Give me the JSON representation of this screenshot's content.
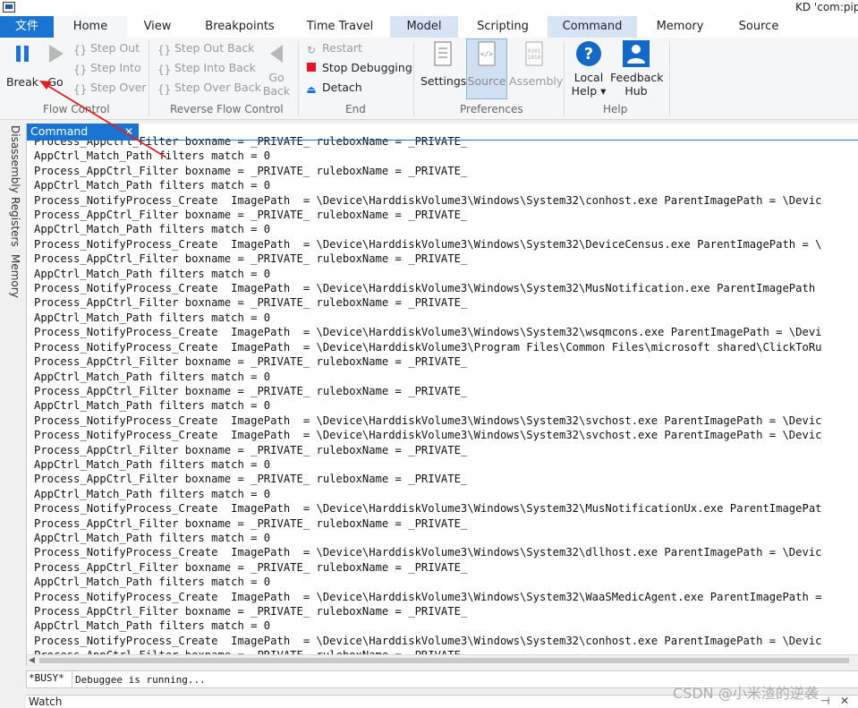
{
  "window": {
    "title": "KD 'com:pip"
  },
  "tabs": [
    "文件",
    "Home",
    "View",
    "Breakpoints",
    "Time Travel",
    "Model",
    "Scripting",
    "Command",
    "Memory",
    "Source"
  ],
  "ribbon": {
    "flow_control": {
      "label": "Flow Control",
      "break": "Break",
      "go": "Go",
      "step_out": "Step Out",
      "step_into": "Step Into",
      "step_over": "Step Over"
    },
    "reverse_flow": {
      "label": "Reverse Flow Control",
      "step_out_back": "Step Out Back",
      "step_into_back": "Step Into Back",
      "step_over_back": "Step Over Back",
      "go_back_1": "Go",
      "go_back_2": "Back"
    },
    "end": {
      "label": "End",
      "restart": "Restart",
      "stop": "Stop Debugging",
      "detach": "Detach"
    },
    "preferences": {
      "label": "Preferences",
      "settings": "Settings",
      "source": "Source",
      "assembly": "Assembly"
    },
    "help": {
      "label": "Help",
      "local_help_1": "Local",
      "local_help_2": "Help ▾",
      "feedback_1": "Feedback",
      "feedback_2": "Hub"
    }
  },
  "side_tabs": [
    "Disassembly",
    "Registers",
    "Memory"
  ],
  "panel": {
    "tab_label": "Command",
    "close_glyph": "✕"
  },
  "output_lines": [
    "Process_AppCtrl_Filter boxname = _PRIVATE_ ruleboxName = _PRIVATE_",
    "AppCtrl_Match_Path filters match = 0",
    "Process_AppCtrl_Filter boxname = _PRIVATE_ ruleboxName = _PRIVATE_",
    "AppCtrl_Match_Path filters match = 0",
    "Process_NotifyProcess_Create  ImagePath  = \\Device\\HarddiskVolume3\\Windows\\System32\\conhost.exe ParentImagePath = \\Devic",
    "Process_AppCtrl_Filter boxname = _PRIVATE_ ruleboxName = _PRIVATE_",
    "AppCtrl_Match_Path filters match = 0",
    "Process_NotifyProcess_Create  ImagePath  = \\Device\\HarddiskVolume3\\Windows\\System32\\DeviceCensus.exe ParentImagePath = \\",
    "Process_AppCtrl_Filter boxname = _PRIVATE_ ruleboxName = _PRIVATE_",
    "AppCtrl_Match_Path filters match = 0",
    "Process_NotifyProcess_Create  ImagePath  = \\Device\\HarddiskVolume3\\Windows\\System32\\MusNotification.exe ParentImagePath",
    "Process_AppCtrl_Filter boxname = _PRIVATE_ ruleboxName = _PRIVATE_",
    "AppCtrl_Match_Path filters match = 0",
    "Process_NotifyProcess_Create  ImagePath  = \\Device\\HarddiskVolume3\\Windows\\System32\\wsqmcons.exe ParentImagePath = \\Devi",
    "Process_NotifyProcess_Create  ImagePath  = \\Device\\HarddiskVolume3\\Program Files\\Common Files\\microsoft shared\\ClickToRu",
    "Process_AppCtrl_Filter boxname = _PRIVATE_ ruleboxName = _PRIVATE_",
    "AppCtrl_Match_Path filters match = 0",
    "Process_AppCtrl_Filter boxname = _PRIVATE_ ruleboxName = _PRIVATE_",
    "AppCtrl_Match_Path filters match = 0",
    "Process_NotifyProcess_Create  ImagePath  = \\Device\\HarddiskVolume3\\Windows\\System32\\svchost.exe ParentImagePath = \\Devic",
    "Process_NotifyProcess_Create  ImagePath  = \\Device\\HarddiskVolume3\\Windows\\System32\\svchost.exe ParentImagePath = \\Devic",
    "Process_AppCtrl_Filter boxname = _PRIVATE_ ruleboxName = _PRIVATE_",
    "AppCtrl_Match_Path filters match = 0",
    "Process_AppCtrl_Filter boxname = _PRIVATE_ ruleboxName = _PRIVATE_",
    "AppCtrl_Match_Path filters match = 0",
    "Process_NotifyProcess_Create  ImagePath  = \\Device\\HarddiskVolume3\\Windows\\System32\\MusNotificationUx.exe ParentImagePat",
    "Process_AppCtrl_Filter boxname = _PRIVATE_ ruleboxName = _PRIVATE_",
    "AppCtrl_Match_Path filters match = 0",
    "Process_NotifyProcess_Create  ImagePath  = \\Device\\HarddiskVolume3\\Windows\\System32\\dllhost.exe ParentImagePath = \\Devic",
    "Process_AppCtrl_Filter boxname = _PRIVATE_ ruleboxName = _PRIVATE_",
    "AppCtrl_Match_Path filters match = 0",
    "Process_NotifyProcess_Create  ImagePath  = \\Device\\HarddiskVolume3\\Windows\\System32\\WaaSMedicAgent.exe ParentImagePath =",
    "Process_AppCtrl_Filter boxname = _PRIVATE_ ruleboxName = _PRIVATE_",
    "AppCtrl_Match_Path filters match = 0",
    "Process_NotifyProcess_Create  ImagePath  = \\Device\\HarddiskVolume3\\Windows\\System32\\conhost.exe ParentImagePath = \\Devic",
    "Process_AppCtrl_Filter boxname = _PRIVATE_ ruleboxName = _PRIVATE_"
  ],
  "status": {
    "busy": "*BUSY*",
    "input_value": "Debuggee is running..."
  },
  "watch": {
    "label": "Watch",
    "pin_glyph": "⊣",
    "close_glyph": "✕"
  },
  "watermark": "CSDN @小米渣的逆袭",
  "colors": {
    "accent": "#1a74d2",
    "stop_red": "#e81123",
    "annotation_arrow": "#e02020",
    "help_icon": "#1469c7"
  },
  "icons": {
    "break": "pause-icon",
    "go": "play-icon",
    "step": "braces-icon",
    "go_back": "back-arrow-icon",
    "restart": "restart-icon",
    "stop": "stop-square-icon",
    "detach": "eject-icon",
    "settings": "document-list-icon",
    "source": "code-file-icon",
    "assembly": "binary-file-icon",
    "local_help": "question-circle-icon",
    "feedback": "person-icon"
  }
}
